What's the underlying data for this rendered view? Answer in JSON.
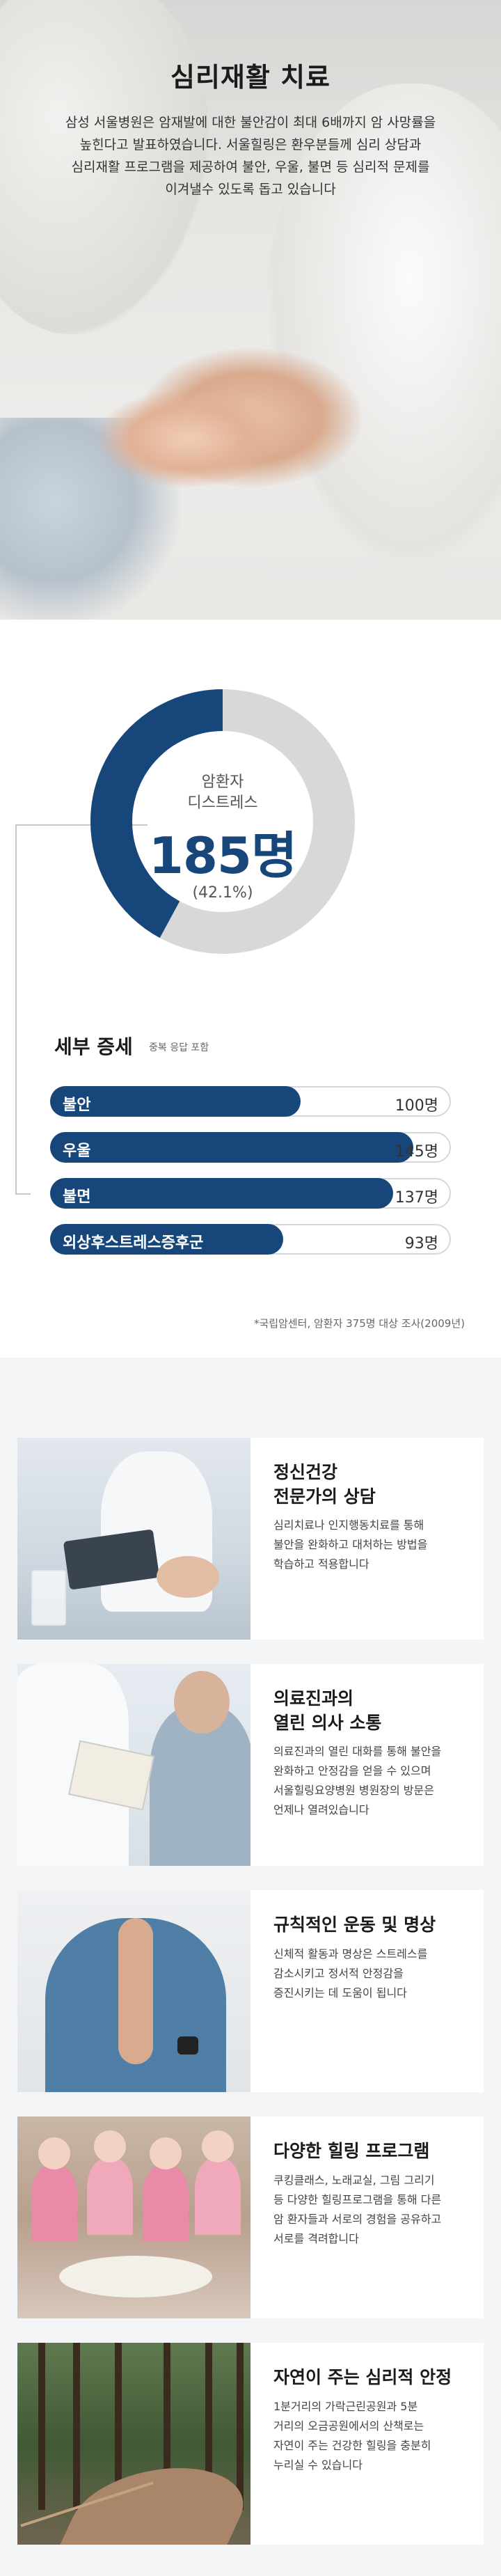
{
  "hero": {
    "title": "심리재활 치료",
    "desc_line1": "삼성 서울병원은 암재발에 대한 불안감이 최대 6배까지 암 사망률을",
    "desc_line2": "높힌다고 발표하였습니다. 서울힐링은 환우분들께 심리 상담과",
    "desc_line3": "심리재활 프로그램을 제공하여 불안, 우울, 불면 등 심리적 문제를",
    "desc_line4": "이겨낼수 있도록 돕고 있습니다"
  },
  "stats": {
    "donut_label_1": "암환자",
    "donut_label_2": "디스트레스",
    "donut_number": "185명",
    "donut_percent": "(42.1%)",
    "donut_fraction": 0.421,
    "colors": {
      "accent": "#17467a",
      "track": "#d8d8d8"
    },
    "detail_title": "세부 증세",
    "detail_note": "중복 응답 포함",
    "source": "*국립암센터, 암환자 375명 대상 조사(2009년)"
  },
  "chart_data": {
    "type": "bar",
    "categories": [
      "불안",
      "우울",
      "불면",
      "외상후스트레스증후군"
    ],
    "values": [
      100,
      145,
      137,
      93
    ],
    "value_labels": [
      "100명",
      "145명",
      "137명",
      "93명"
    ],
    "xlabel": "",
    "ylabel": "",
    "title": ""
  },
  "programs": [
    {
      "title_line1": "정신건강",
      "title_line2": "전문가의 상담",
      "text": [
        "심리치료나 인지행동치료를 통해",
        "불안을 완화하고 대처하는 방법을",
        "학습하고 적용합니다"
      ]
    },
    {
      "title_line1": "의료진과의",
      "title_line2": "열린 의사 소통",
      "text": [
        "의료진과의 열린 대화를 통해 불안을",
        "완화하고 안정감을 얻을 수 있으며",
        "서울힐링요양병원 병원장의 방문은",
        "언제나 열려있습니다"
      ]
    },
    {
      "title_line1": "규칙적인 운동 및 명상",
      "title_line2": "",
      "text": [
        "신체적 활동과 명상은 스트레스를",
        "감소시키고 정서적 안정감을",
        "증진시키는 데 도움이 됩니다"
      ]
    },
    {
      "title_line1": "다양한 힐링 프로그램",
      "title_line2": "",
      "text": [
        "쿠킹클래스, 노래교실, 그림 그리기",
        "등 다양한 힐링프로그램을 통해 다른",
        "암 환자들과 서로의 경험을 공유하고",
        "서로를 격려합니다"
      ]
    },
    {
      "title_line1": "자연이 주는 심리적 안정",
      "title_line2": "",
      "text": [
        "1분거리의 가락근린공원과 5분",
        "거리의 오금공원에서의 산책로는",
        "자연이 주는 건강한 힐링을 충분히",
        "누리실 수 있습니다"
      ]
    }
  ]
}
